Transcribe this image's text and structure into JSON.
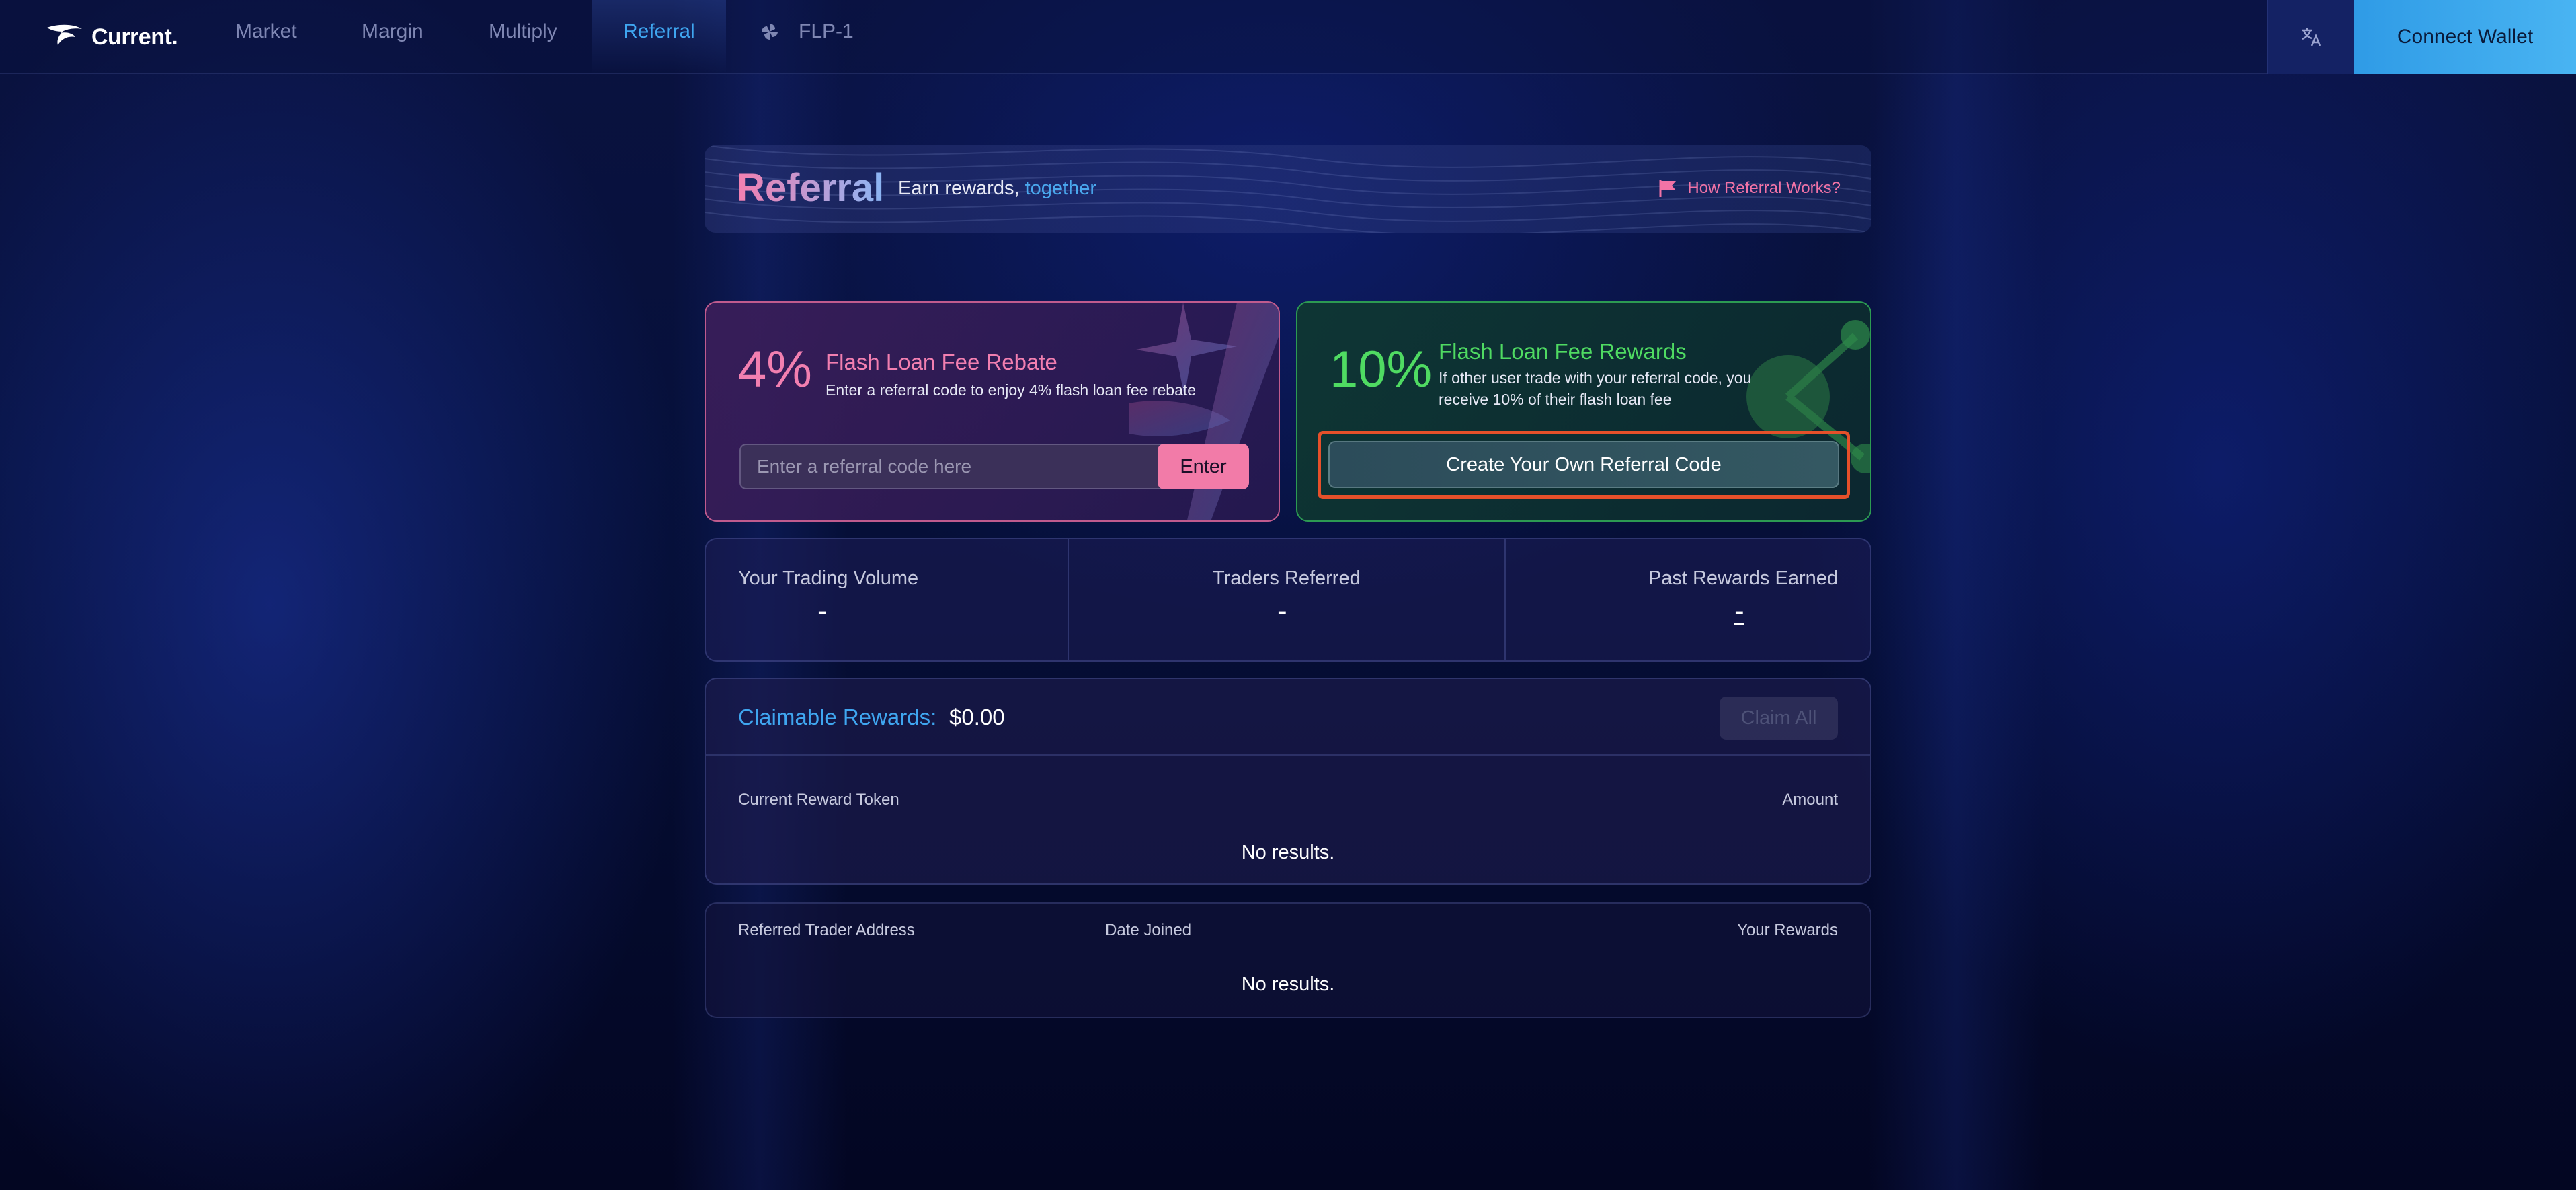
{
  "app": {
    "name": "Current."
  },
  "nav": {
    "items": [
      "Market",
      "Margin",
      "Multiply",
      "Referral"
    ],
    "active": "Referral",
    "flp_label": "FLP-1"
  },
  "header_actions": {
    "connect_wallet": "Connect Wallet",
    "language_icon": "translate-icon"
  },
  "hero": {
    "title": "Referral",
    "subtitle_prefix": "Earn rewards,",
    "subtitle_accent": "together",
    "how_link": "How Referral Works?"
  },
  "rebate": {
    "percent": "4%",
    "title": "Flash Loan Fee Rebate",
    "description": "Enter a referral code to enjoy 4% flash loan fee rebate",
    "input_placeholder": "Enter a referral code here",
    "input_value": "",
    "button": "Enter"
  },
  "rewards": {
    "percent": "10%",
    "title": "Flash Loan Fee Rewards",
    "description_line1": "If other user trade with your referral code, you",
    "description_line2": "receive 10% of their flash loan fee",
    "button": "Create Your Own Referral Code"
  },
  "stats": [
    {
      "label": "Your Trading Volume",
      "value": "-"
    },
    {
      "label": "Traders Referred",
      "value": "-"
    },
    {
      "label": "Past Rewards Earned",
      "value": "-"
    }
  ],
  "claimable": {
    "label": "Claimable Rewards:",
    "amount": "$0.00",
    "button": "Claim All",
    "columns": [
      "Current Reward Token",
      "Amount"
    ],
    "empty": "No results."
  },
  "referred": {
    "columns": [
      "Referred Trader Address",
      "Date Joined",
      "Your Rewards"
    ],
    "empty": "No results."
  },
  "colors": {
    "accent_blue": "#3fa6f0",
    "pink": "#f27fb0",
    "green": "#4fdb62",
    "highlight": "#e5502a"
  }
}
